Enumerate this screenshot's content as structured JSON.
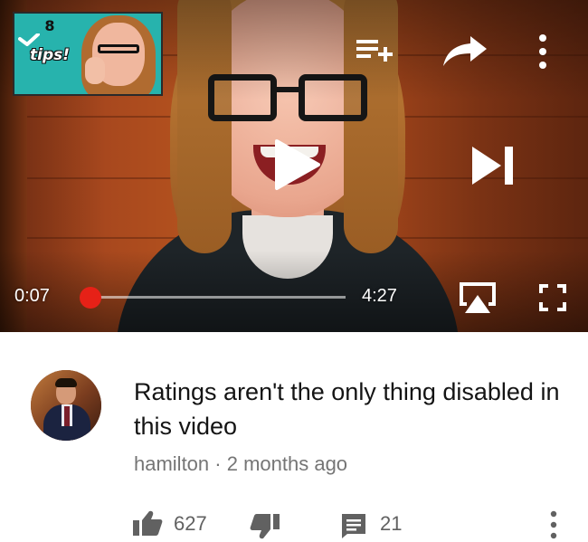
{
  "player": {
    "thumbnail": {
      "number": "8",
      "label": "tips!"
    },
    "current_time": "0:07",
    "total_time": "4:27",
    "progress": 0.026,
    "icons": {
      "add_to_queue": "add-to-queue-icon",
      "share": "share-icon",
      "more": "more-vert-icon",
      "play": "play-icon",
      "next": "skip-next-icon",
      "airplay": "airplay-icon",
      "fullscreen": "fullscreen-icon"
    },
    "accent_color": "#e62117"
  },
  "comment": {
    "text": "Ratings aren't the only thing disabled in this video",
    "author": "hamilton",
    "separator": "·",
    "time": "2 months ago",
    "likes": "627",
    "replies": "21"
  }
}
